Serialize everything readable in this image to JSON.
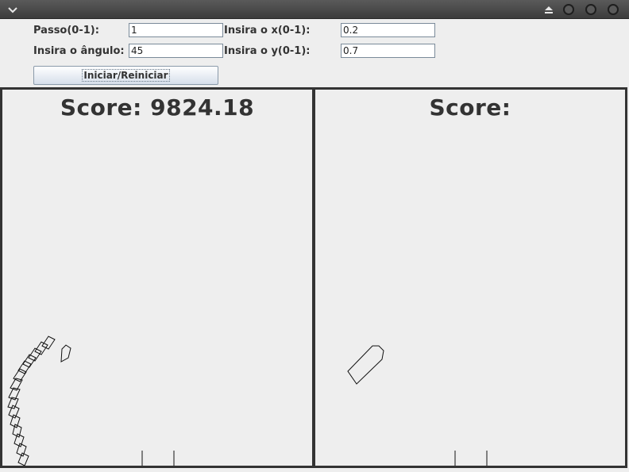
{
  "titlebar": {
    "menu_icon": "chevron-down-icon",
    "eject_icon": "eject-icon",
    "controls": [
      "window-control-icon",
      "window-control-icon",
      "window-control-icon"
    ]
  },
  "form": {
    "step_label": "Passo(0-1):",
    "step_value": "1",
    "angle_label": "Insira o ângulo:",
    "angle_value": "45",
    "x_label": "Insira o x(0-1):",
    "x_value": "0.2",
    "y_label": "Insira o y(0-1):",
    "y_value": "0.7",
    "start_button": "Iniciar/Reiniciar"
  },
  "panels": {
    "left": {
      "score_text": "Score: 9824.18"
    },
    "right": {
      "score_text": "Score:"
    }
  }
}
